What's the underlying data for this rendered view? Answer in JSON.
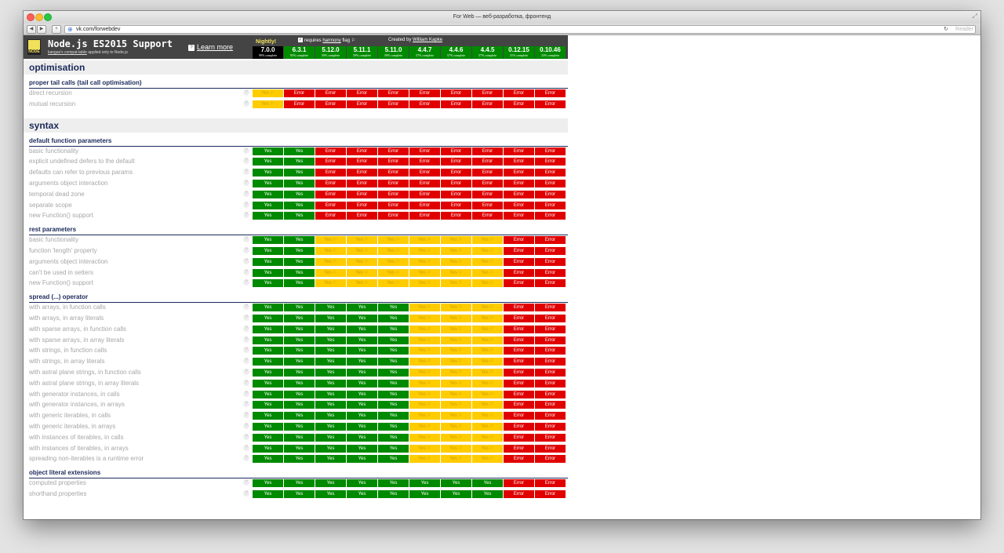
{
  "browser": {
    "window_title": "For Web — веб-разработка, фронтенд",
    "url": "vk.com/forwebdev",
    "reader_label": "Reader",
    "back_label": "◀",
    "forward_label": "▶",
    "add_label": "+"
  },
  "header": {
    "logo_text": "NODE",
    "title": "Node.js ES2015 Support",
    "subtitle_link": "kangax's compat-table",
    "subtitle_rest": " applied only to Node.js",
    "learn_more": "Learn more",
    "nightly": "Nightly!",
    "flag_prefix": "requires ",
    "flag_link": "harmony",
    "flag_suffix": " flag ⚐",
    "credit_prefix": "Created by ",
    "credit_link": "William Kapke",
    "versions": [
      {
        "name": "7.0.0",
        "pct": "99% complete",
        "style": "dark"
      },
      {
        "name": "6.3.1",
        "pct": "95% complete",
        "style": "green"
      },
      {
        "name": "5.12.0",
        "pct": "59% complete",
        "style": "green"
      },
      {
        "name": "5.11.1",
        "pct": "59% complete",
        "style": "green"
      },
      {
        "name": "5.11.0",
        "pct": "59% complete",
        "style": "green"
      },
      {
        "name": "4.4.7",
        "pct": "57% complete",
        "style": "green"
      },
      {
        "name": "4.4.6",
        "pct": "57% complete",
        "style": "green"
      },
      {
        "name": "4.4.5",
        "pct": "57% complete",
        "style": "green"
      },
      {
        "name": "0.12.15",
        "pct": "31% complete",
        "style": "green"
      },
      {
        "name": "0.10.46",
        "pct": "23% complete",
        "style": "green"
      }
    ]
  },
  "labels": {
    "Y": "Yes",
    "P": "Yes ⚐",
    "E": "Error",
    "help": "?"
  },
  "sections": [
    {
      "title": "optimisation",
      "groups": [
        {
          "name": "proper tail calls (tail call optimisation)",
          "rows": [
            {
              "label": "direct recursion",
              "cells": "PEEEEEEEEE"
            },
            {
              "label": "mutual recursion",
              "cells": "PEEEEEEEEE"
            }
          ]
        }
      ]
    },
    {
      "title": "syntax",
      "groups": [
        {
          "name": "default function parameters",
          "rows": [
            {
              "label": "basic functionality",
              "cells": "YYEEEEEEEE"
            },
            {
              "label": "explicit undefined defers to the default",
              "cells": "YYEEEEEEEE"
            },
            {
              "label": "defaults can refer to previous params",
              "cells": "YYEEEEEEEE"
            },
            {
              "label": "arguments object interaction",
              "cells": "YYEEEEEEEE"
            },
            {
              "label": "temporal dead zone",
              "cells": "YYEEEEEEEE"
            },
            {
              "label": "separate scope",
              "cells": "YYEEEEEEEE"
            },
            {
              "label": "new Function() support",
              "cells": "YYEEEEEEEE"
            }
          ]
        },
        {
          "name": "rest parameters",
          "rows": [
            {
              "label": "basic functionality",
              "cells": "YYPPPPPPEE"
            },
            {
              "label": "function 'length' property",
              "cells": "YYPPPPPPEE"
            },
            {
              "label": "arguments object interaction",
              "cells": "YYPPPPPPEE"
            },
            {
              "label": "can't be used in setters",
              "cells": "YYPPPPPPEE"
            },
            {
              "label": "new Function() support",
              "cells": "YYPPPPPPEE"
            }
          ]
        },
        {
          "name": "spread (...) operator",
          "rows": [
            {
              "label": "with arrays, in function calls",
              "cells": "YYYYYPPPEE"
            },
            {
              "label": "with arrays, in array literals",
              "cells": "YYYYYPPPEE"
            },
            {
              "label": "with sparse arrays, in function calls",
              "cells": "YYYYYPPPEE"
            },
            {
              "label": "with sparse arrays, in array literals",
              "cells": "YYYYYPPPEE"
            },
            {
              "label": "with strings, in function calls",
              "cells": "YYYYYPPPEE"
            },
            {
              "label": "with strings, in array literals",
              "cells": "YYYYYPPPEE"
            },
            {
              "label": "with astral plane strings, in function calls",
              "cells": "YYYYYPPPEE"
            },
            {
              "label": "with astral plane strings, in array literals",
              "cells": "YYYYYPPPEE"
            },
            {
              "label": "with generator instances, in calls",
              "cells": "YYYYYPPPEE"
            },
            {
              "label": "with generator instances, in arrays",
              "cells": "YYYYYPPPEE"
            },
            {
              "label": "with generic iterables, in calls",
              "cells": "YYYYYPPPEE"
            },
            {
              "label": "with generic iterables, in arrays",
              "cells": "YYYYYPPPEE"
            },
            {
              "label": "with instances of iterables, in calls",
              "cells": "YYYYYPPPEE"
            },
            {
              "label": "with instances of iterables, in arrays",
              "cells": "YYYYYPPPEE"
            },
            {
              "label": "spreading non-iterables is a runtime error",
              "cells": "YYYYYPPPEE"
            }
          ]
        },
        {
          "name": "object literal extensions",
          "rows": [
            {
              "label": "computed properties",
              "cells": "YYYYYYYYEE"
            },
            {
              "label": "shorthand properties",
              "cells": "YYYYYYYYEE"
            }
          ]
        }
      ]
    }
  ]
}
